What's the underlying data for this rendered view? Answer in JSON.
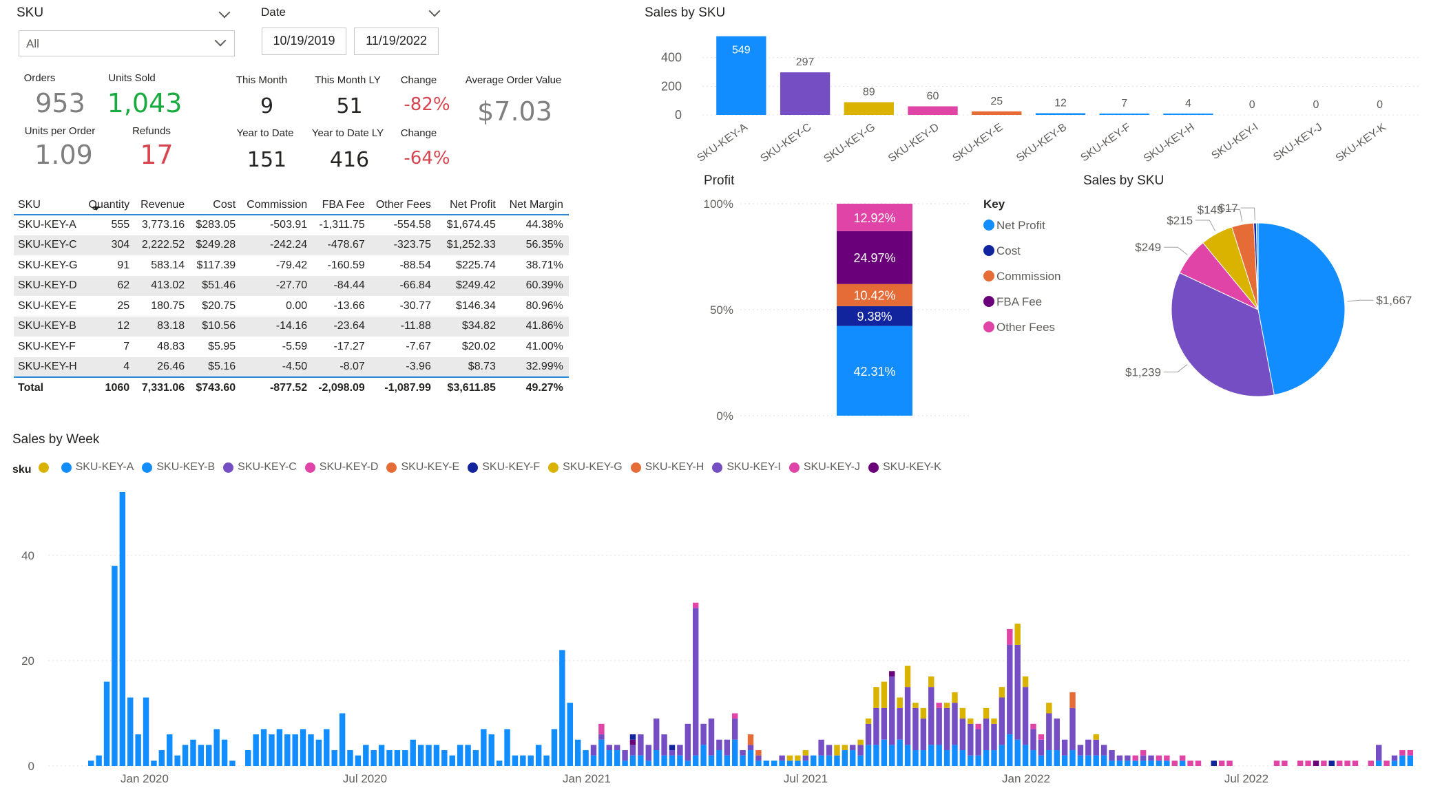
{
  "slicers": {
    "sku": {
      "title": "SKU",
      "value": "All"
    },
    "date": {
      "title": "Date",
      "start": "10/19/2019",
      "end": "11/19/2022"
    }
  },
  "kpis": {
    "orders": {
      "label": "Orders",
      "value": "953"
    },
    "units_sold": {
      "label": "Units Sold",
      "value": "1,043"
    },
    "units_per_order": {
      "label": "Units per Order",
      "value": "1.09"
    },
    "refunds": {
      "label": "Refunds",
      "value": "17"
    },
    "this_month": {
      "label": "This Month",
      "value": "9"
    },
    "this_month_ly": {
      "label": "This Month LY",
      "value": "51"
    },
    "change_month": {
      "label": "Change",
      "value": "-82%"
    },
    "ytd": {
      "label": "Year to Date",
      "value": "151"
    },
    "ytd_ly": {
      "label": "Year to Date LY",
      "value": "416"
    },
    "change_ytd": {
      "label": "Change",
      "value": "-64%"
    },
    "aov": {
      "label": "Average Order Value",
      "value": "$7.03"
    }
  },
  "colors": {
    "blue": "#118DFF",
    "navy": "#12239E",
    "orange": "#E66C37",
    "purple": "#6B007B",
    "pink": "#E044A7",
    "violet": "#744EC2",
    "gold": "#D9B300",
    "green": "#1AAB40",
    "red": "#D64550",
    "gray": "#7f7f7f"
  },
  "table": {
    "headers": [
      "SKU",
      "Quantity",
      "Revenue",
      "Cost",
      "Commission",
      "FBA Fee",
      "Other Fees",
      "Net Profit",
      "Net Margin"
    ],
    "rows": [
      [
        "SKU-KEY-A",
        "555",
        "3,773.16",
        "$283.05",
        "-503.91",
        "-1,311.75",
        "-554.58",
        "$1,674.45",
        "44.38%"
      ],
      [
        "SKU-KEY-C",
        "304",
        "2,222.52",
        "$249.28",
        "-242.24",
        "-478.67",
        "-323.75",
        "$1,252.33",
        "56.35%"
      ],
      [
        "SKU-KEY-G",
        "91",
        "583.14",
        "$117.39",
        "-79.42",
        "-160.59",
        "-88.54",
        "$225.74",
        "38.71%"
      ],
      [
        "SKU-KEY-D",
        "62",
        "413.02",
        "$51.46",
        "-27.70",
        "-84.44",
        "-66.84",
        "$249.42",
        "60.39%"
      ],
      [
        "SKU-KEY-E",
        "25",
        "180.75",
        "$20.75",
        "0.00",
        "-13.66",
        "-30.77",
        "$146.34",
        "80.96%"
      ],
      [
        "SKU-KEY-B",
        "12",
        "83.18",
        "$10.56",
        "-14.16",
        "-23.64",
        "-11.88",
        "$34.82",
        "41.86%"
      ],
      [
        "SKU-KEY-F",
        "7",
        "48.83",
        "$5.95",
        "-5.59",
        "-17.27",
        "-7.67",
        "$20.02",
        "41.00%"
      ],
      [
        "SKU-KEY-H",
        "4",
        "26.46",
        "$5.16",
        "-4.50",
        "-8.07",
        "-3.96",
        "$8.73",
        "32.99%"
      ]
    ],
    "total": [
      "Total",
      "1060",
      "7,331.06",
      "$743.60",
      "-877.52",
      "-2,098.09",
      "-1,087.99",
      "$3,611.85",
      "49.27%"
    ]
  },
  "chart_data": [
    {
      "type": "bar",
      "title": "Sales by SKU",
      "categories": [
        "SKU-KEY-A",
        "SKU-KEY-C",
        "SKU-KEY-G",
        "SKU-KEY-D",
        "SKU-KEY-E",
        "SKU-KEY-B",
        "SKU-KEY-F",
        "SKU-KEY-H",
        "SKU-KEY-I",
        "SKU-KEY-J",
        "SKU-KEY-K"
      ],
      "values": [
        549,
        297,
        89,
        60,
        25,
        12,
        7,
        4,
        0,
        0,
        0
      ],
      "colors": [
        "#118DFF",
        "#744EC2",
        "#D9B300",
        "#E044A7",
        "#E66C37",
        "#118DFF",
        "#118DFF",
        "#118DFF",
        "#744EC2",
        "#E044A7",
        "#6B007B"
      ],
      "yticks": [
        0,
        200,
        400
      ],
      "ylim": [
        0,
        600
      ]
    },
    {
      "type": "bar",
      "stacked": "100%",
      "title": "Profit",
      "legend_title": "Key",
      "yticks": [
        "0%",
        "50%",
        "100%"
      ],
      "segments": [
        {
          "name": "Net Profit",
          "value": 42.31,
          "label": "42.31%",
          "color": "#118DFF"
        },
        {
          "name": "Cost",
          "value": 9.38,
          "label": "9.38%",
          "color": "#12239E"
        },
        {
          "name": "Commission",
          "value": 10.42,
          "label": "10.42%",
          "color": "#E66C37"
        },
        {
          "name": "FBA Fee",
          "value": 24.97,
          "label": "24.97%",
          "color": "#6B007B"
        },
        {
          "name": "Other Fees",
          "value": 12.92,
          "label": "12.92%",
          "color": "#E044A7"
        }
      ]
    },
    {
      "type": "pie",
      "title": "Sales by SKU",
      "slices": [
        {
          "label": "$1,667",
          "value": 1667,
          "color": "#118DFF"
        },
        {
          "label": "$1,239",
          "value": 1239,
          "color": "#744EC2"
        },
        {
          "label": "$249",
          "value": 249,
          "color": "#E044A7"
        },
        {
          "label": "$215",
          "value": 215,
          "color": "#D9B300"
        },
        {
          "label": "$145",
          "value": 145,
          "color": "#E66C37"
        },
        {
          "label": "$17",
          "value": 17,
          "color": "#12239E"
        },
        {
          "label": "",
          "value": 12,
          "color": "#118DFF"
        }
      ]
    },
    {
      "type": "bar",
      "stacked": true,
      "title": "Sales by Week",
      "legend_title": "sku",
      "legend": [
        {
          "name": "",
          "color": "#D9B300"
        },
        {
          "name": "SKU-KEY-A",
          "color": "#118DFF"
        },
        {
          "name": "SKU-KEY-B",
          "color": "#118DFF"
        },
        {
          "name": "SKU-KEY-C",
          "color": "#744EC2"
        },
        {
          "name": "SKU-KEY-D",
          "color": "#E044A7"
        },
        {
          "name": "SKU-KEY-E",
          "color": "#E66C37"
        },
        {
          "name": "SKU-KEY-F",
          "color": "#12239E"
        },
        {
          "name": "SKU-KEY-G",
          "color": "#D9B300"
        },
        {
          "name": "SKU-KEY-H",
          "color": "#E66C37"
        },
        {
          "name": "SKU-KEY-I",
          "color": "#744EC2"
        },
        {
          "name": "SKU-KEY-J",
          "color": "#E044A7"
        },
        {
          "name": "SKU-KEY-K",
          "color": "#6B007B"
        }
      ],
      "xticks": [
        "Jan 2020",
        "Jul 2020",
        "Jan 2021",
        "Jul 2021",
        "Jan 2022",
        "Jul 2022"
      ],
      "yticks": [
        0,
        20,
        40
      ],
      "ylim": [
        0,
        52
      ],
      "series_order": [
        "A",
        "C",
        "K",
        "F",
        "G",
        "D",
        "E"
      ],
      "series_colors": {
        "A": "#118DFF",
        "C": "#744EC2",
        "K": "#6B007B",
        "F": "#12239E",
        "G": "#D9B300",
        "D": "#E044A7",
        "E": "#E66C37"
      },
      "weeks": [
        {
          "A": 1
        },
        {
          "A": 2
        },
        {
          "A": 16
        },
        {
          "A": 38
        },
        {
          "A": 52
        },
        {
          "A": 13
        },
        {
          "A": 6
        },
        {
          "A": 13
        },
        {
          "A": 1
        },
        {
          "A": 3
        },
        {
          "A": 6
        },
        {
          "A": 2
        },
        {
          "A": 4
        },
        {
          "A": 5
        },
        {
          "A": 4
        },
        {
          "A": 4
        },
        {
          "A": 7
        },
        {
          "A": 5
        },
        {
          "A": 1
        },
        {},
        {
          "A": 3
        },
        {
          "A": 6
        },
        {
          "A": 7
        },
        {
          "A": 6
        },
        {
          "A": 7
        },
        {
          "A": 6
        },
        {
          "A": 6
        },
        {
          "A": 7
        },
        {
          "A": 6
        },
        {
          "A": 5
        },
        {
          "A": 7
        },
        {
          "A": 3
        },
        {
          "A": 10
        },
        {
          "A": 3
        },
        {
          "A": 2
        },
        {
          "A": 4
        },
        {
          "A": 3
        },
        {
          "A": 4
        },
        {
          "A": 3
        },
        {
          "A": 3
        },
        {
          "A": 3
        },
        {
          "A": 5
        },
        {
          "A": 4
        },
        {
          "A": 4
        },
        {
          "A": 4
        },
        {
          "A": 3
        },
        {
          "A": 2
        },
        {
          "A": 4
        },
        {
          "A": 4
        },
        {
          "A": 3
        },
        {
          "A": 7
        },
        {
          "A": 6
        },
        {
          "A": 1
        },
        {
          "A": 7
        },
        {
          "A": 2
        },
        {
          "A": 2
        },
        {
          "A": 2
        },
        {
          "A": 4
        },
        {
          "A": 2
        },
        {
          "A": 7
        },
        {
          "A": 22
        },
        {
          "A": 12
        },
        {
          "A": 5
        },
        {
          "A": 3
        },
        {
          "A": 2,
          "C": 2
        },
        {
          "A": 5,
          "C": 1,
          "D": 2
        },
        {
          "A": 3,
          "C": 1
        },
        {
          "A": 3,
          "C": 1
        },
        {
          "A": 1,
          "C": 2
        },
        {
          "A": 2,
          "C": 2,
          "K": 1,
          "F": 1
        },
        {
          "A": 2,
          "C": 4
        },
        {
          "A": 1,
          "C": 3
        },
        {
          "A": 3,
          "C": 6
        },
        {
          "A": 2,
          "C": 4
        },
        {
          "A": 2,
          "C": 1,
          "F": 1
        },
        {
          "A": 2,
          "C": 2
        },
        {
          "A": 1,
          "C": 7
        },
        {
          "A": 2,
          "C": 28,
          "D": 1
        },
        {
          "A": 4,
          "C": 4
        },
        {
          "A": 2,
          "C": 7
        },
        {
          "A": 3,
          "C": 2
        },
        {
          "A": 2,
          "C": 3
        },
        {
          "A": 5,
          "C": 4,
          "D": 1
        },
        {
          "A": 2,
          "C": 1
        },
        {
          "A": 3,
          "C": 1,
          "E": 2
        },
        {
          "A": 1,
          "C": 1,
          "E": 1
        },
        {
          "A": 1
        },
        {
          "A": 1
        },
        {
          "A": 1,
          "C": 1
        },
        {
          "A": 1,
          "G": 1
        },
        {
          "A": 1,
          "G": 1
        },
        {
          "A": 1,
          "C": 1,
          "G": 1
        },
        {
          "A": 2
        },
        {
          "A": 2,
          "C": 3
        },
        {
          "A": 2,
          "C": 2
        },
        {
          "A": 2,
          "G": 2
        },
        {
          "A": 3,
          "G": 1
        },
        {
          "A": 3,
          "C": 1
        },
        {
          "A": 2,
          "C": 2,
          "G": 1
        },
        {
          "A": 4,
          "C": 4,
          "G": 1
        },
        {
          "A": 4,
          "C": 7,
          "G": 4
        },
        {
          "A": 5,
          "C": 6,
          "G": 5
        },
        {
          "A": 4,
          "C": 13,
          "K": 1
        },
        {
          "A": 5,
          "C": 6,
          "G": 2
        },
        {
          "A": 4,
          "C": 11,
          "G": 4
        },
        {
          "A": 3,
          "C": 8,
          "G": 1
        },
        {
          "A": 3,
          "C": 6,
          "G": 2
        },
        {
          "A": 4,
          "C": 11,
          "G": 2
        },
        {
          "A": 4,
          "C": 7,
          "D": 1
        },
        {
          "A": 3,
          "C": 8,
          "G": 1
        },
        {
          "A": 4,
          "C": 8,
          "G": 2
        },
        {
          "A": 3,
          "C": 6,
          "G": 2
        },
        {
          "A": 2,
          "C": 6,
          "G": 1
        },
        {
          "A": 2,
          "C": 5,
          "D": 1
        },
        {
          "A": 3,
          "C": 6,
          "G": 2
        },
        {
          "A": 3,
          "C": 5,
          "G": 1
        },
        {
          "A": 4,
          "C": 9,
          "G": 2
        },
        {
          "A": 6,
          "C": 17,
          "D": 3
        },
        {
          "A": 5,
          "C": 18,
          "G": 4
        },
        {
          "A": 4,
          "C": 11,
          "G": 2
        },
        {
          "A": 3,
          "C": 4,
          "D": 1
        },
        {
          "A": 2,
          "C": 3,
          "D": 1
        },
        {
          "A": 3,
          "C": 7,
          "G": 2
        },
        {
          "A": 3,
          "C": 6
        },
        {
          "A": 2,
          "C": 3
        },
        {
          "A": 3,
          "C": 8,
          "E": 3
        },
        {
          "A": 2,
          "C": 2
        },
        {
          "A": 2,
          "C": 3
        },
        {
          "A": 2,
          "C": 3,
          "G": 1
        },
        {
          "A": 2,
          "C": 2
        },
        {
          "A": 1,
          "C": 2
        },
        {
          "A": 1,
          "C": 1
        },
        {
          "A": 1,
          "C": 1
        },
        {
          "A": 1,
          "D": 1
        },
        {
          "A": 1,
          "C": 1,
          "D": 1
        },
        {
          "A": 1,
          "C": 1
        },
        {
          "A": 1,
          "D": 1
        },
        {
          "A": 1,
          "D": 1
        },
        {
          "D": 1
        },
        {
          "A": 1,
          "D": 1
        },
        {
          "D": 1
        },
        {
          "D": 1
        },
        {},
        {
          "F": 1
        },
        {
          "D": 1
        },
        {
          "D": 1
        },
        {},
        {},
        {},
        {},
        {},
        {
          "D": 1
        },
        {
          "D": 1
        },
        {},
        {
          "D": 1
        },
        {
          "D": 1
        },
        {
          "K": 1
        },
        {
          "D": 1
        },
        {
          "F": 1
        },
        {
          "D": 1
        },
        {
          "D": 1
        },
        {
          "D": 1
        },
        {},
        {
          "D": 1
        },
        {
          "A": 1,
          "C": 3
        },
        {
          "D": 1
        },
        {
          "A": 1,
          "C": 1
        },
        {
          "A": 2,
          "D": 1
        },
        {
          "A": 2,
          "D": 1
        }
      ]
    }
  ]
}
